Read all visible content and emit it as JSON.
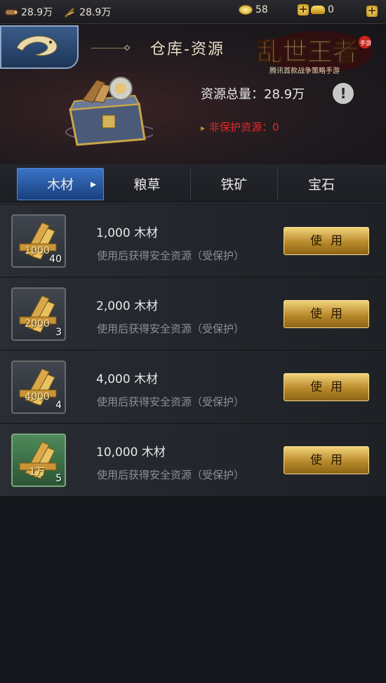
{
  "topbar": {
    "wood": "28.9万",
    "second_resource": "28.9万",
    "coins": "58",
    "ingots": "0"
  },
  "header": {
    "title": "仓库-资源",
    "logo_text": "乱世王者",
    "logo_subtitle": "腾讯首款战争策略手游",
    "logo_badge": "手游",
    "total_label": "资源总量：28.9万",
    "nonprotected_label": "非保护资源：0"
  },
  "tabs": [
    {
      "label": "木材",
      "active": true
    },
    {
      "label": "粮草",
      "active": false
    },
    {
      "label": "铁矿",
      "active": false
    },
    {
      "label": "宝石",
      "active": false
    }
  ],
  "items": [
    {
      "badge": "1000",
      "count": "40",
      "title": "1,000  木材",
      "desc": "使用后获得安全资源（受保护）",
      "button": "使用",
      "frame": "gray"
    },
    {
      "badge": "2000",
      "count": "3",
      "title": "2,000  木材",
      "desc": "使用后获得安全资源（受保护）",
      "button": "使用",
      "frame": "gray"
    },
    {
      "badge": "4000",
      "count": "4",
      "title": "4,000  木材",
      "desc": "使用后获得安全资源（受保护）",
      "button": "使用",
      "frame": "gray"
    },
    {
      "badge": "1万",
      "count": "5",
      "title": "10,000  木材",
      "desc": "使用后获得安全资源（受保护）",
      "button": "使用",
      "frame": "green"
    }
  ],
  "colors": {
    "accent_blue": "#2f66b8",
    "gold_button": "#c99a3a",
    "warning_red": "#e02a2a"
  }
}
